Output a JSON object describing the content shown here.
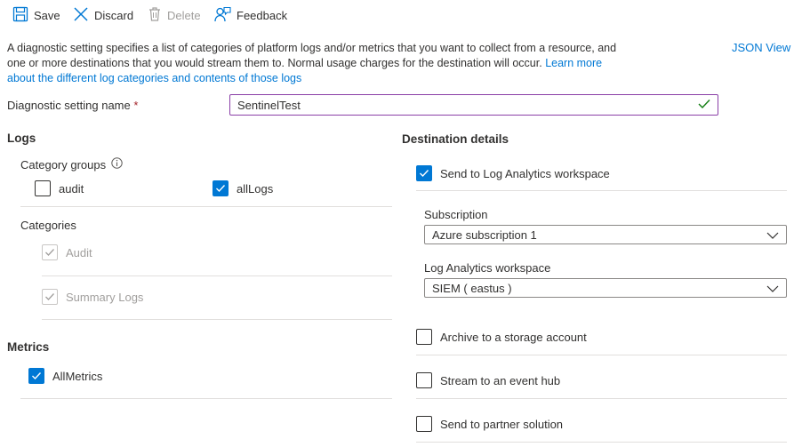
{
  "toolbar": {
    "save": "Save",
    "discard": "Discard",
    "delete": "Delete",
    "feedback": "Feedback"
  },
  "description": {
    "text": "A diagnostic setting specifies a list of categories of platform logs and/or metrics that you want to collect from a resource, and one or more destinations that you would stream them to. Normal usage charges for the destination will occur.",
    "link": "Learn more about the different log categories and contents of those logs",
    "json_view": "JSON View"
  },
  "name_field": {
    "label": "Diagnostic setting name",
    "required": "*",
    "value": "SentinelTest"
  },
  "logs": {
    "title": "Logs",
    "category_groups_label": "Category groups",
    "groups": [
      {
        "label": "audit",
        "checked": false
      },
      {
        "label": "allLogs",
        "checked": true
      }
    ],
    "categories_label": "Categories",
    "categories": [
      {
        "label": "Audit",
        "checked": true,
        "disabled": true
      },
      {
        "label": "Summary Logs",
        "checked": true,
        "disabled": true
      }
    ]
  },
  "metrics": {
    "title": "Metrics",
    "items": [
      {
        "label": "AllMetrics",
        "checked": true
      }
    ]
  },
  "destination": {
    "title": "Destination details",
    "log_analytics": {
      "label": "Send to Log Analytics workspace",
      "checked": true
    },
    "subscription_label": "Subscription",
    "subscription_value": "Azure subscription 1",
    "workspace_label": "Log Analytics workspace",
    "workspace_value": "SIEM ( eastus )",
    "storage": {
      "label": "Archive to a storage account",
      "checked": false
    },
    "event_hub": {
      "label": "Stream to an event hub",
      "checked": false
    },
    "partner": {
      "label": "Send to partner solution",
      "checked": false
    }
  },
  "colors": {
    "accent": "#0078d4",
    "focus_border": "#8a3fa7",
    "valid_check": "#107c10",
    "required": "#a4262c"
  }
}
